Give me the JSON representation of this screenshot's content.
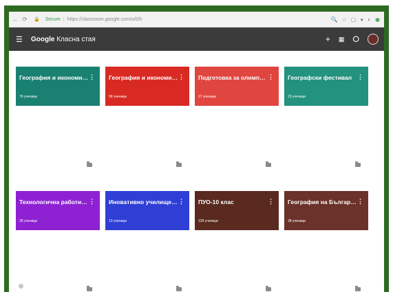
{
  "browser": {
    "secure_label": "Secure",
    "url": "https://classroom.google.com/u/0/h"
  },
  "app": {
    "title_brand": "Google",
    "title_name": "Класна стая",
    "add_glyph": "+",
    "apps_glyph": "⋮⋮"
  },
  "cards": [
    {
      "title": "География и икономи…",
      "students": "76 ученици",
      "color": "#1a8172"
    },
    {
      "title": "География и икономи…",
      "students": "58 ученици",
      "color": "#d82a22"
    },
    {
      "title": "Подготовка за олимп…",
      "students": "27 ученици",
      "color": "#e0453f"
    },
    {
      "title": "Географски фестивал",
      "students": "23 ученици",
      "color": "#23927e"
    },
    {
      "title": "Технологична работи…",
      "students": "28 ученици",
      "color": "#8e22d2"
    },
    {
      "title": "Иновативно училище…",
      "students": "13 ученици",
      "color": "#2f3fd6"
    },
    {
      "title": "ПУО-10 клас",
      "students": "128 ученици",
      "color": "#5a2a1f"
    },
    {
      "title": "География на Българ…",
      "students": "38 ученици",
      "color": "#6b3229"
    }
  ],
  "icons": {
    "back": "back-arrow-icon",
    "reload": "reload-icon",
    "menu": "hamburger-menu-icon",
    "more": "more-vert-icon",
    "folder": "folder-icon",
    "avatar": "avatar"
  }
}
